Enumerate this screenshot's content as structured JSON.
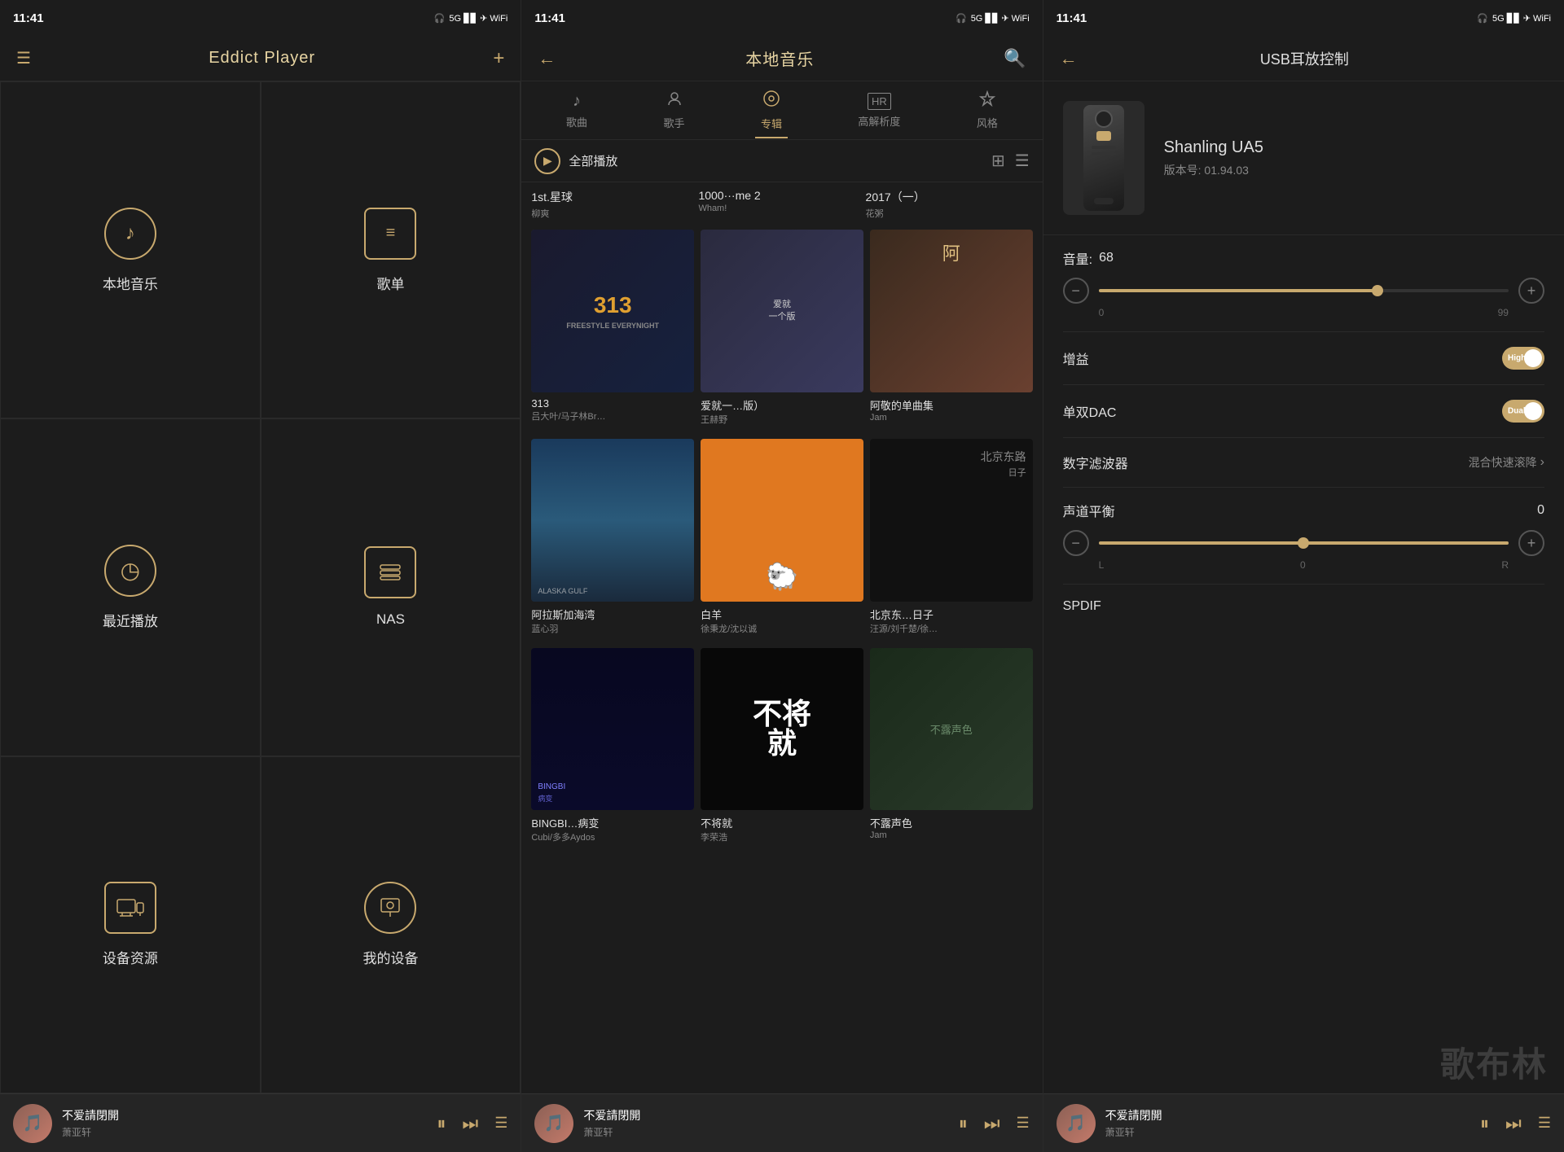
{
  "panel1": {
    "status_time": "11:41",
    "header_title": "Eddict  Player",
    "grid_items": [
      {
        "id": "local-music",
        "label": "本地音乐",
        "icon": "♪"
      },
      {
        "id": "playlist",
        "label": "歌单",
        "icon": "≡"
      },
      {
        "id": "recent",
        "label": "最近播放",
        "icon": "◷"
      },
      {
        "id": "nas",
        "label": "NAS",
        "icon": "≡"
      },
      {
        "id": "device-source",
        "label": "设备资源",
        "icon": "⊞"
      },
      {
        "id": "my-device",
        "label": "我的设备",
        "icon": "👤"
      }
    ],
    "player": {
      "title": "不爱請閉開",
      "artist": "萧亚轩"
    }
  },
  "panel2": {
    "status_time": "11:41",
    "header_title": "本地音乐",
    "tabs": [
      {
        "id": "songs",
        "label": "歌曲",
        "icon": "♪"
      },
      {
        "id": "artists",
        "label": "歌手",
        "icon": "👤"
      },
      {
        "id": "albums",
        "label": "专辑",
        "icon": "◎",
        "active": true
      },
      {
        "id": "hires",
        "label": "高解析度",
        "icon": "HR"
      },
      {
        "id": "style",
        "label": "风格",
        "icon": "♦"
      }
    ],
    "play_all": "全部播放",
    "first_row_albums": [
      {
        "name": "1st.星球",
        "artist": "柳爽"
      },
      {
        "name": "1000···me  2",
        "artist": "Wham!"
      },
      {
        "name": "2017（一）",
        "artist": "花粥"
      }
    ],
    "albums": [
      {
        "name": "313",
        "artist": "吕大叶/马子林Br…",
        "cover_type": "313"
      },
      {
        "name": "爱就一…版）",
        "artist": "王赫野",
        "cover_type": "love"
      },
      {
        "name": "阿敬的单曲集",
        "artist": "Jam",
        "cover_type": "adear"
      },
      {
        "name": "阿拉斯加海湾",
        "artist": "蓝心羽",
        "cover_type": "alaska"
      },
      {
        "name": "白羊",
        "artist": "徐秉龙/沈以诚",
        "cover_type": "whitesheep"
      },
      {
        "name": "北京东…日子",
        "artist": "汪源/刘千楚/徐…",
        "cover_type": "beijing"
      },
      {
        "name": "BINGBI…病变",
        "artist": "Cubi/多多Aydos",
        "cover_type": "bing"
      },
      {
        "name": "不将就",
        "artist": "李荣浩",
        "cover_type": "notyield"
      },
      {
        "name": "不露声色",
        "artist": "Jam",
        "cover_type": "hidden"
      }
    ],
    "player": {
      "title": "不爱請閉開",
      "artist": "萧亚轩"
    }
  },
  "panel3": {
    "status_time": "11:41",
    "header_title": "USB耳放控制",
    "device": {
      "name": "Shanling  UA5",
      "version": "版本号: 01.94.03"
    },
    "controls": {
      "volume_label": "音量:",
      "volume_value": "68",
      "volume_min": "0",
      "volume_max": "99",
      "volume_pct": 68,
      "gain_label": "增益",
      "gain_value": "High",
      "dac_label": "单双DAC",
      "dac_value": "Dual",
      "filter_label": "数字滤波器",
      "filter_value": "混合快速滚降",
      "balance_label": "声道平衡",
      "balance_value": "0",
      "spdif_label": "SPDIF"
    },
    "player": {
      "title": "不爱請閉開",
      "artist": "萧亚轩"
    },
    "watermark": "歌布林"
  }
}
